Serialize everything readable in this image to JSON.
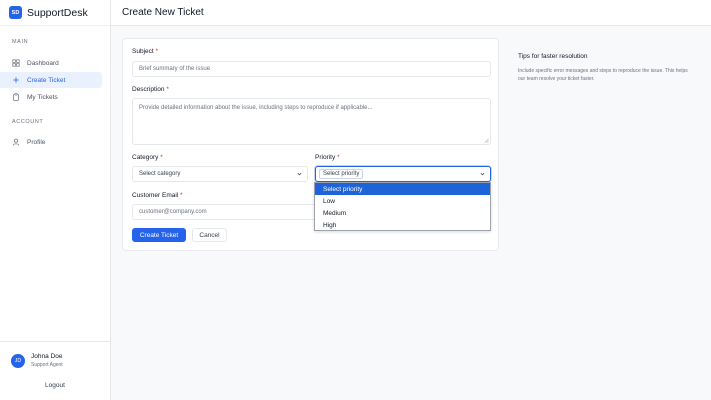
{
  "brand": {
    "logo_text": "SD",
    "name": "SupportDesk",
    "color": "#2563eb"
  },
  "sidebar": {
    "main_label": "MAIN",
    "items": [
      {
        "label": "Dashboard",
        "icon": "grid-icon",
        "active": false
      },
      {
        "label": "Create Ticket",
        "icon": "plus-icon",
        "active": true
      },
      {
        "label": "My Tickets",
        "icon": "clipboard-icon",
        "active": false
      }
    ],
    "account_label": "ACCOUNT",
    "account_items": [
      {
        "label": "Profile",
        "icon": "user-icon",
        "active": false
      }
    ]
  },
  "user": {
    "initials": "JD",
    "name": "Johna Doe",
    "role": "Support Agent",
    "logout_label": "Logout"
  },
  "header": {
    "title": "Create New Ticket"
  },
  "form": {
    "subject": {
      "label": "Subject",
      "required_mark": "*",
      "placeholder": "Brief summary of the issue"
    },
    "description": {
      "label": "Description",
      "required_mark": "*",
      "placeholder": "Provide detailed information about the issue, including steps to reproduce if applicable..."
    },
    "category": {
      "label": "Category",
      "required_mark": "*",
      "value": "Select category"
    },
    "priority": {
      "label": "Priority",
      "required_mark": "*",
      "value": "Select priority",
      "options": [
        "Select priority",
        "Low",
        "Medium",
        "High"
      ],
      "highlighted_index": 0
    },
    "email": {
      "label": "Customer Email",
      "required_mark": "*",
      "placeholder": "customer@company.com"
    },
    "submit_label": "Create Ticket",
    "cancel_label": "Cancel"
  },
  "tips": {
    "title": "Tips for faster resolution",
    "body": "Include specific error messages and steps to reproduce the issue. This helps our team resolve your ticket faster."
  }
}
